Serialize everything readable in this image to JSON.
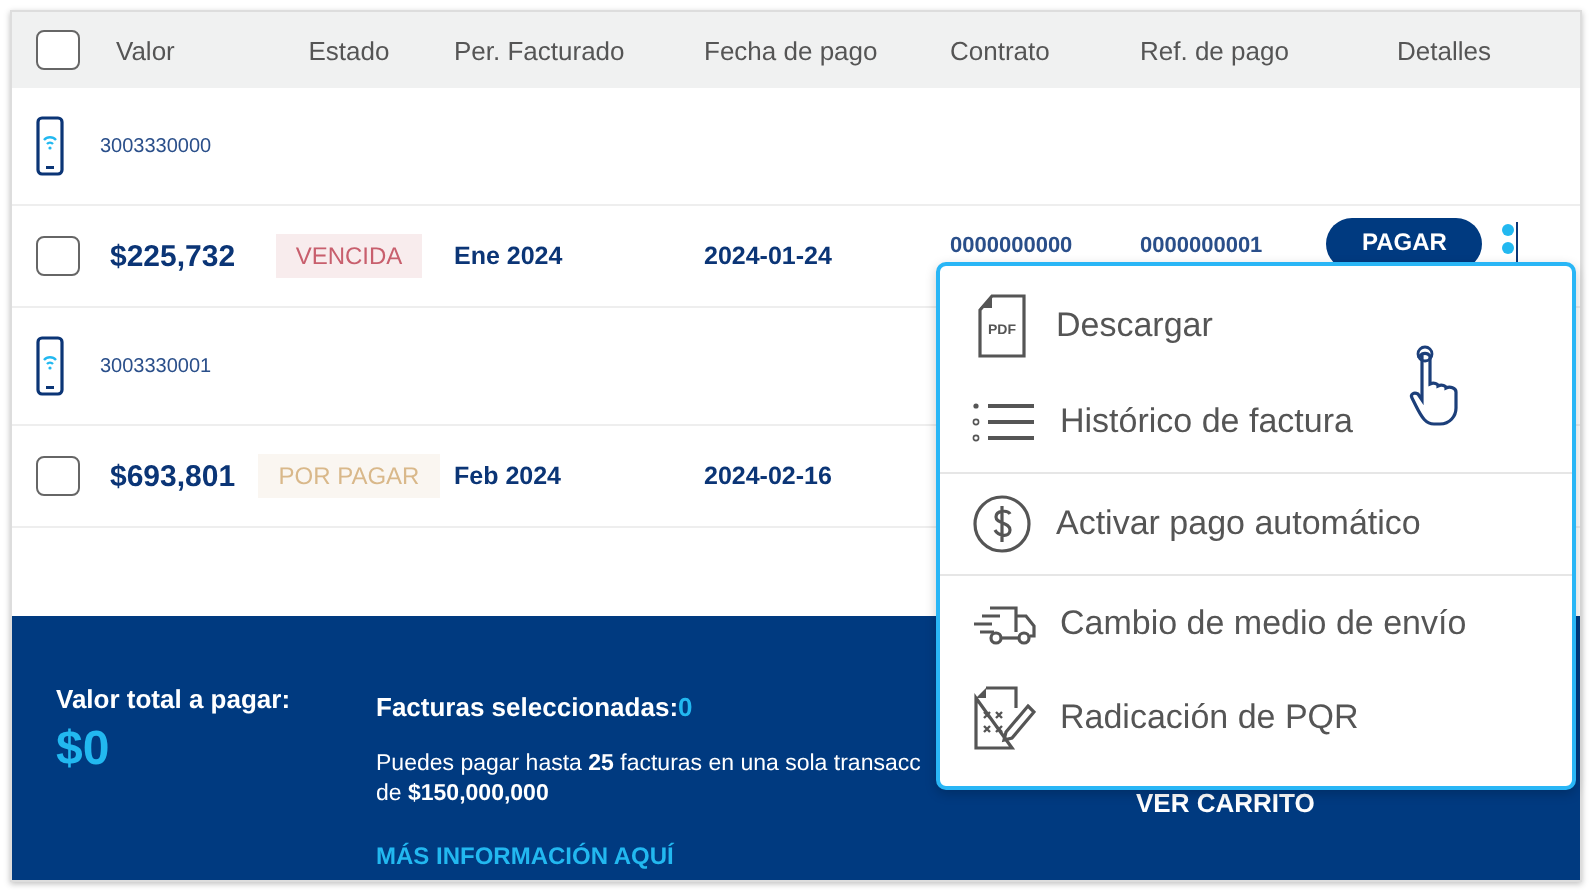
{
  "table": {
    "select_all": {
      "checked": false
    },
    "columns": [
      "Valor",
      "Estado",
      "Per. Facturado",
      "Fecha de pago",
      "Contrato",
      "Ref. de pago",
      "Detalles"
    ],
    "groups": [
      {
        "line": "3003330000",
        "invoice": {
          "checked": false,
          "value": "$225,732",
          "status": "VENCIDA",
          "color": "#c85f6d",
          "period": "Ene 2024",
          "date": "2024-01-24",
          "contract": "0000000000",
          "reference": "0000000001",
          "pay_button": "PAGAR"
        }
      },
      {
        "line": "3003330001",
        "invoice": {
          "checked": false,
          "value": "$693,801",
          "status": "POR PAGAR",
          "color": "#d9b88a",
          "period": "Feb 2024",
          "date": "2024-02-16"
        }
      }
    ]
  },
  "summary": {
    "total_label": "Valor total a pagar:",
    "total": "$0",
    "selected_label": "Facturas seleccionadas:",
    "selected_count": "0",
    "info_lines": [
      "Puedes pagar hasta **25** facturas en una sola transacc",
      "de **$150,000,000**"
    ],
    "info_link": "MÁS INFORMACIÓN AQUÍ",
    "cart_button": "VER CARRITO"
  },
  "menu": {
    "items": [
      {
        "kind": "pdf",
        "icon_text": "PDF",
        "label": "Descargar",
        "divider_after": false
      },
      {
        "kind": "list",
        "label": "Histórico de factura",
        "divider_after": true
      },
      {
        "kind": "dollar",
        "label": "Activar pago automático",
        "divider_after": true
      },
      {
        "kind": "truck",
        "label": "Cambio de medio de envío",
        "divider_after": false
      },
      {
        "kind": "form",
        "label": "Radicación de PQR",
        "divider_after": false
      }
    ]
  }
}
